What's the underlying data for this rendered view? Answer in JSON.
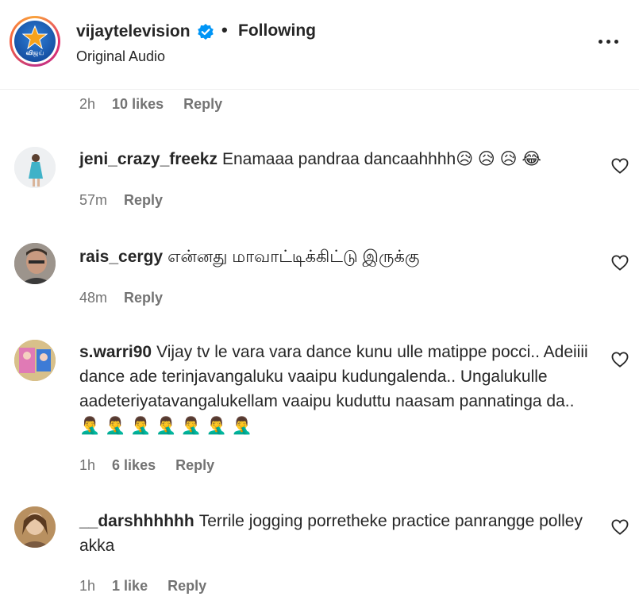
{
  "header": {
    "avatar_brand": "விஜய்",
    "username": "vijaytelevision",
    "separator": "•",
    "follow_label": "Following",
    "audio_label": "Original Audio",
    "more_icon": "more-horizontal-icon"
  },
  "top_meta": {
    "time": "2h",
    "likes": "10 likes",
    "reply": "Reply"
  },
  "comments": [
    {
      "username": "jeni_crazy_freekz",
      "text": "Enamaaa pandraa dancaahhhh😥 😥 😥 😂",
      "time": "57m",
      "likes": "",
      "reply": "Reply"
    },
    {
      "username": "rais_cergy",
      "text": "என்னது மாவாட்டிக்கிட்டு இருக்கு",
      "time": "48m",
      "likes": "",
      "reply": "Reply"
    },
    {
      "username": "s.warri90",
      "text": "Vijay tv le vara vara dance kunu ulle matippe pocci.. Adeiiii dance ade terinjavangaluku vaaipu kudungalenda.. Ungalukulle aadeteriyatavangalukellam vaaipu kuduttu naasam pannatinga da.. 🤦‍♂️ 🤦‍♂️ 🤦‍♂️ 🤦‍♂️ 🤦‍♂️ 🤦‍♂️ 🤦‍♂️",
      "time": "1h",
      "likes": "6 likes",
      "reply": "Reply"
    },
    {
      "username": "__darshhhhhh",
      "text": "Terrile jogging porretheke practice panrangge polley akka",
      "time": "1h",
      "likes": "1 like",
      "reply": "Reply"
    }
  ],
  "colors": {
    "text": "#262626",
    "secondary": "#737373",
    "verified": "#0095f6",
    "divider": "#efefef"
  }
}
